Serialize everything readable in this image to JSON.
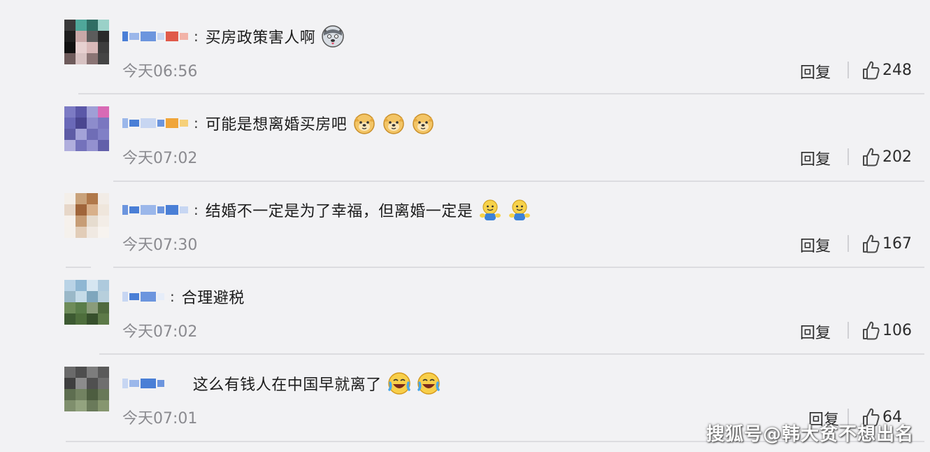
{
  "comments": [
    {
      "text": "买房政策害人啊",
      "time": "今天06:56",
      "reply_label": "回复",
      "likes": "248",
      "emojis": [
        "husky-emoji"
      ],
      "avatar": [
        "#3a3a3a",
        "#4fa79a",
        "#2f6e64",
        "#9ad1c8",
        "#1e1e1e",
        "#c9a8a8",
        "#5c5c5c",
        "#2a2a2a",
        "#111111",
        "#e6d0d0",
        "#d9b9b9",
        "#3d3d3d",
        "#6e5b5b",
        "#d7c2c2",
        "#8a7474",
        "#444444"
      ],
      "user_blocks": [
        "#4a7fd6",
        "#9bb7ea",
        "#6c95de",
        "#c7d6f2",
        "#e05a4a",
        "#f2b3a8"
      ]
    },
    {
      "text": "可能是想离婚买房吧",
      "time": "今天07:02",
      "reply_label": "回复",
      "likes": "202",
      "emojis": [
        "doge-emoji",
        "doge-emoji",
        "doge-emoji"
      ],
      "avatar": [
        "#7c7bc4",
        "#5b58a8",
        "#9f9fd6",
        "#d86ab5",
        "#6a69b8",
        "#4a4690",
        "#8d8ccc",
        "#7a77c0",
        "#5e5ca6",
        "#a3a2d8",
        "#6f6db6",
        "#8180c6",
        "#b0aedd",
        "#7472bb",
        "#9391cf",
        "#6260aa"
      ],
      "user_blocks": [
        "#9bb7ea",
        "#4a7fd6",
        "#c7d6f2",
        "#6c95de",
        "#f0a53a",
        "#f6d07a"
      ]
    },
    {
      "text": "结婚不一定是为了幸福，但离婚一定是",
      "time": "今天07:30",
      "reply_label": "回复",
      "likes": "167",
      "emojis": [
        "hug-emoji",
        "hug-emoji"
      ],
      "avatar": [
        "#f4efe9",
        "#c9a27a",
        "#b0784a",
        "#f2ece6",
        "#e7d7c8",
        "#a0653a",
        "#d8b08a",
        "#efe6dc",
        "#f6f1ec",
        "#c79d76",
        "#e6dccf",
        "#f3ede7",
        "#f5f1ec",
        "#e2cdb8",
        "#f0e9e2",
        "#f7f3ef"
      ],
      "user_blocks": [
        "#6c95de",
        "#4a7fd6",
        "#9bb7ea",
        "#6c95de",
        "#4a7fd6",
        "#c7d6f2"
      ]
    },
    {
      "text": "合理避税",
      "time": "今天07:02",
      "reply_label": "回复",
      "likes": "106",
      "emojis": [],
      "avatar": [
        "#b9d3e6",
        "#8fb7d3",
        "#d6e6f1",
        "#aecadd",
        "#9ab8c8",
        "#c5dbe8",
        "#7fa6bd",
        "#b7cfdc",
        "#6e8c5a",
        "#5a7d4a",
        "#8a9c7a",
        "#4f6a3e",
        "#3d5a32",
        "#4e6e3c",
        "#37502c",
        "#5d7a48"
      ],
      "user_blocks": [
        "#c7d6f2",
        "#4a7fd6",
        "#6c95de",
        "#e6edf9"
      ]
    },
    {
      "text": "这么有钱人在中国早就离了",
      "time": "今天07:01",
      "reply_label": "回复",
      "likes": "64",
      "emojis": [
        "laugh-cry-emoji",
        "laugh-cry-emoji"
      ],
      "avatar": [
        "#6a6a6a",
        "#4e4e4e",
        "#7d7d7d",
        "#5a5a5a",
        "#3f3f3f",
        "#8c8c8c",
        "#505050",
        "#6f6f6f",
        "#5e6e50",
        "#728261",
        "#4d5d40",
        "#687858",
        "#7f8f6d",
        "#93a37f",
        "#6a7a5a",
        "#86966f"
      ],
      "user_blocks": [
        "#c7d6f2",
        "#9bb7ea",
        "#4a7fd6",
        "#6c95de"
      ]
    }
  ],
  "watermark": "搜狐号@韩大贫不想出名"
}
